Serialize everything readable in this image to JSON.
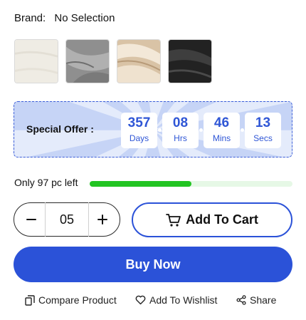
{
  "brand": {
    "label": "Brand:",
    "value": "No Selection"
  },
  "swatches": [
    {
      "name": "cream",
      "color": "#efece4"
    },
    {
      "name": "grey",
      "color": "#9a9a9a"
    },
    {
      "name": "champagne",
      "color": "#e8d7c0"
    },
    {
      "name": "black",
      "color": "#2a2a2a"
    }
  ],
  "offer": {
    "label": "Special Offer :",
    "countdown": [
      {
        "value": "357",
        "unit": "Days"
      },
      {
        "value": "08",
        "unit": "Hrs"
      },
      {
        "value": "46",
        "unit": "Mins"
      },
      {
        "value": "13",
        "unit": "Secs"
      }
    ]
  },
  "stock": {
    "text": "Only 97 pc left",
    "level_fraction": 0.5
  },
  "quantity": {
    "minus": "−",
    "value": "05",
    "plus": "+"
  },
  "actions": {
    "add_to_cart": "Add To Cart",
    "buy_now": "Buy Now"
  },
  "links": {
    "compare": "Compare Product",
    "wishlist": "Add To Wishlist",
    "share": "Share"
  },
  "colors": {
    "accent": "#2b52d8",
    "progress": "#22c422"
  }
}
